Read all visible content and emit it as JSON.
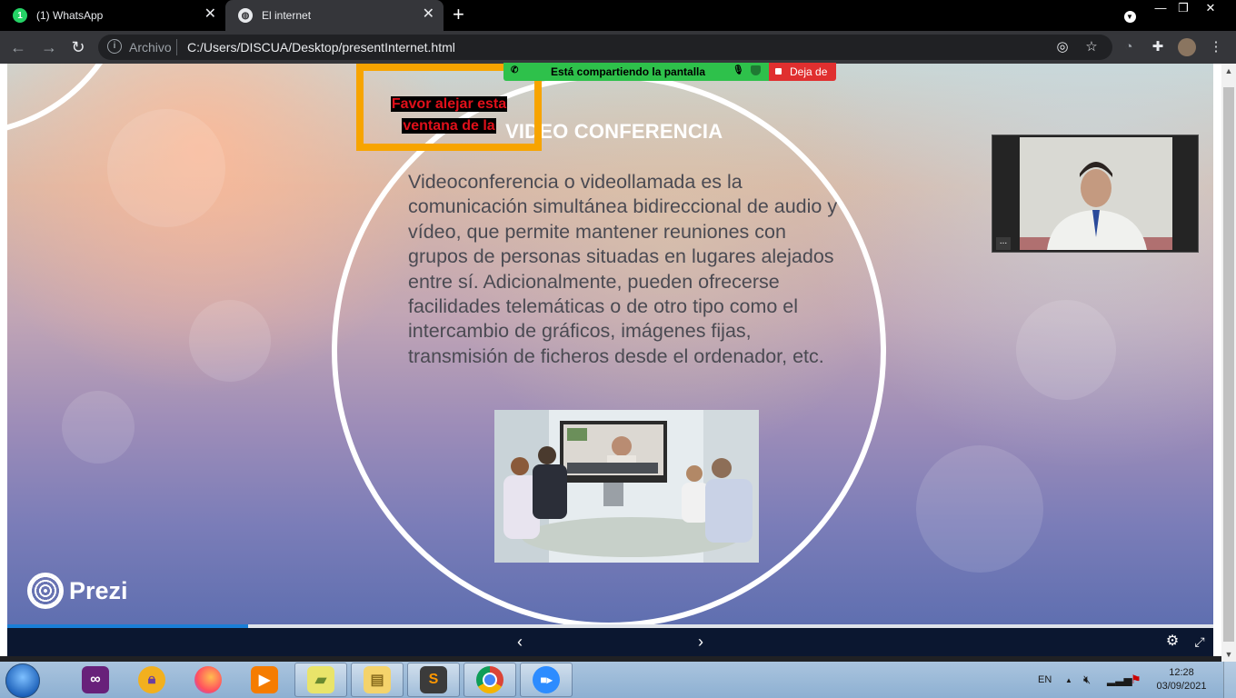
{
  "browser": {
    "tabs": [
      {
        "title": "(1) WhatsApp",
        "favicon_badge": "1",
        "active": false
      },
      {
        "title": "El internet",
        "active": true
      }
    ],
    "new_tab": "+",
    "window_controls": {
      "minimize": "—",
      "restore": "❐",
      "close": "✕"
    },
    "address": {
      "scheme_label": "Archivo",
      "url": "C:/Users/DISCUA/Desktop/presentInternet.html"
    }
  },
  "screen_share": {
    "status_text": "Está compartiendo la pantalla",
    "stop_label": "Deja de",
    "colors": {
      "bar": "#2ec14b",
      "stop": "#e02f2f"
    }
  },
  "notice": {
    "text_line1": "Favor alejar esta",
    "text_line2": "ventana de la",
    "border_color": "#f7a400",
    "text_color": "#e0101a"
  },
  "slide": {
    "title": "VIDEO CONFERENCIA",
    "body": "Videoconferencia o videollamada es la comunicación simultánea bidireccional de audio y vídeo, que permite mantener reuniones con grupos de personas situadas en lugares alejados entre sí. Adicionalmente, pueden ofrecerse facilidades telemáticas o de otro tipo como el intercambio de gráficos, imágenes fijas, transmisión de ficheros desde el ordenador, etc.",
    "brand": "Prezi",
    "progress": 0.2
  },
  "camera_overlay": {
    "menu_label": "..."
  },
  "taskbar": {
    "apps": [
      "visual-studio-icon",
      "keepass-icon",
      "firefox-icon",
      "media-player-icon",
      "sticky-notes-icon",
      "file-explorer-icon",
      "sublime-text-icon",
      "chrome-icon",
      "zoom-icon"
    ],
    "language": "EN",
    "time": "12:28",
    "date": "03/09/2021"
  }
}
